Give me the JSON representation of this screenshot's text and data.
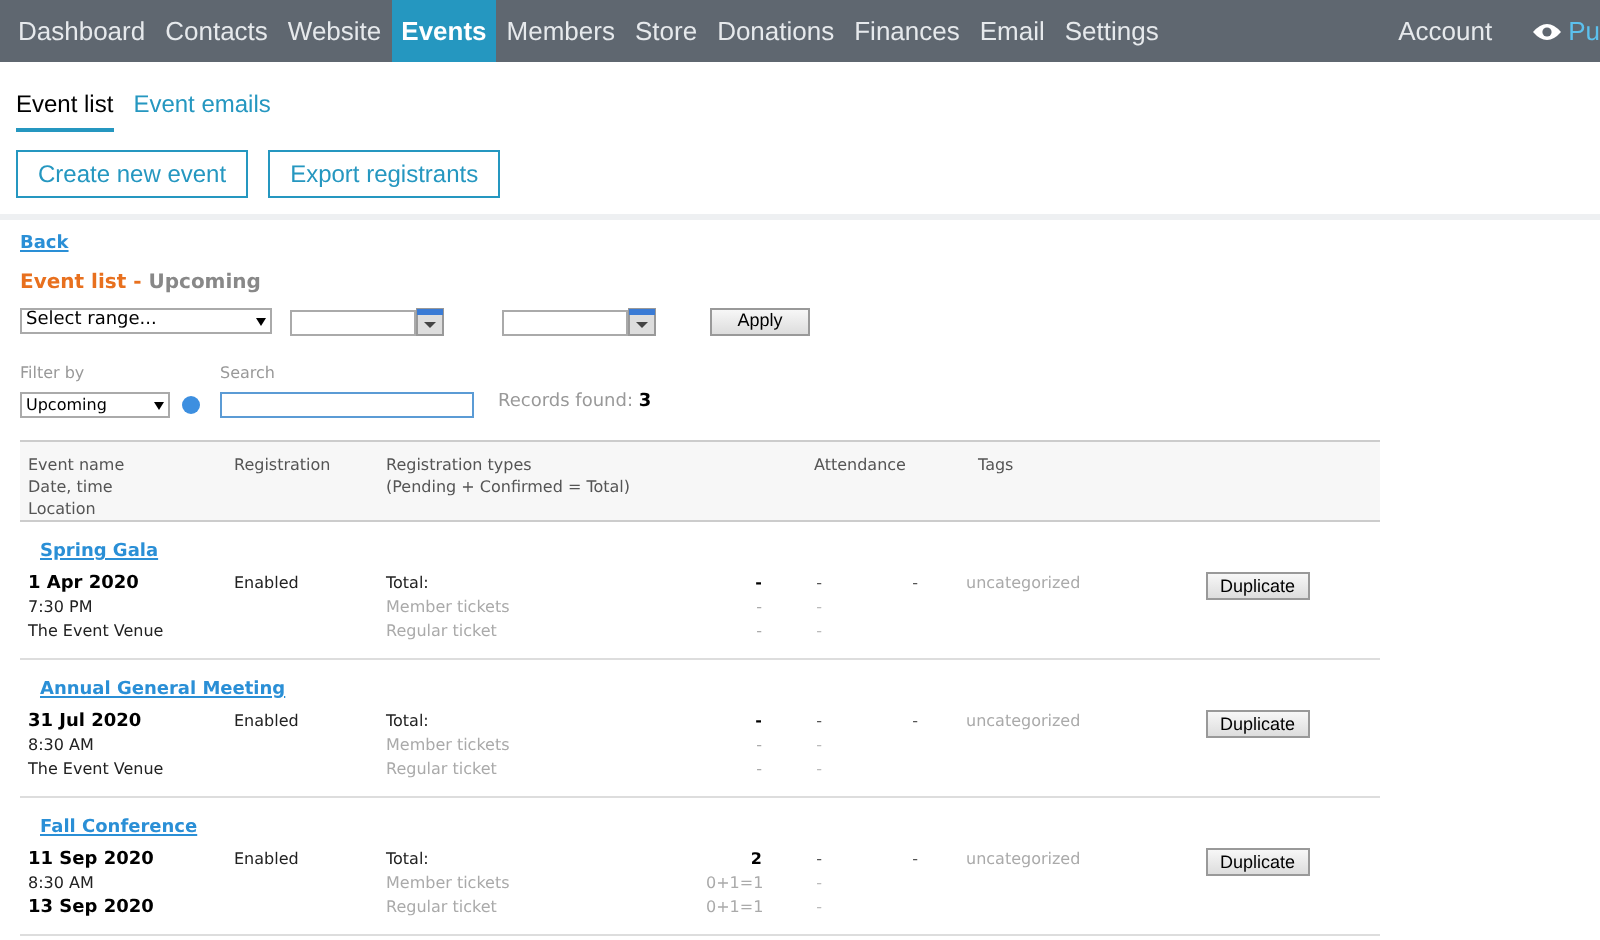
{
  "nav": {
    "items": [
      {
        "label": "Dashboard",
        "selected": false
      },
      {
        "label": "Contacts",
        "selected": false
      },
      {
        "label": "Website",
        "selected": false
      },
      {
        "label": "Events",
        "selected": true
      },
      {
        "label": "Members",
        "selected": false
      },
      {
        "label": "Store",
        "selected": false
      },
      {
        "label": "Donations",
        "selected": false
      },
      {
        "label": "Finances",
        "selected": false
      },
      {
        "label": "Email",
        "selected": false
      },
      {
        "label": "Settings",
        "selected": false
      }
    ],
    "account": "Account",
    "preview": "Pu"
  },
  "tabs": [
    {
      "label": "Event list",
      "selected": true
    },
    {
      "label": "Event emails",
      "selected": false
    }
  ],
  "actions": [
    "Create new event",
    "Export registrants"
  ],
  "back": "Back",
  "heading": {
    "title": "Event list",
    "separator": "-",
    "subtitle": "Upcoming"
  },
  "range": {
    "select": "Select range...",
    "apply": "Apply"
  },
  "filter": {
    "label": "Filter by",
    "value": "Upcoming"
  },
  "search": {
    "label": "Search"
  },
  "records": {
    "label": "Records found:",
    "count": "3"
  },
  "table": {
    "columns": [
      {
        "lines": [
          "Event name",
          "Date, time",
          "Location"
        ]
      },
      {
        "lines": [
          "Registration"
        ]
      },
      {
        "lines": [
          "Registration types",
          "(Pending + Confirmed = Total)"
        ]
      },
      {
        "lines": [
          "Attendance"
        ]
      },
      {
        "lines": [
          "Tags"
        ]
      }
    ],
    "rows": [
      {
        "name": "Spring Gala",
        "details": [
          {
            "text": "1 Apr 2020",
            "kind": "date"
          },
          {
            "text": "7:30 PM",
            "kind": "plain"
          },
          {
            "text": "The Event Venue",
            "kind": "plain"
          }
        ],
        "registration": "Enabled",
        "types": [
          {
            "kind": "total",
            "label": "Total:",
            "count": "-",
            "column_5": "-"
          },
          {
            "kind": "type",
            "label": "Member tickets",
            "count": "-",
            "column_5": "-"
          },
          {
            "kind": "type",
            "label": "Regular ticket",
            "count": "-",
            "column_5": "-"
          }
        ],
        "attendance": "-",
        "tags": "uncategorized",
        "button": "Duplicate"
      },
      {
        "name": "Annual General Meeting",
        "details": [
          {
            "text": "31 Jul 2020",
            "kind": "date"
          },
          {
            "text": "8:30 AM",
            "kind": "plain"
          },
          {
            "text": "The Event Venue",
            "kind": "plain"
          }
        ],
        "registration": "Enabled",
        "types": [
          {
            "kind": "total",
            "label": "Total:",
            "count": "-",
            "column_5": "-"
          },
          {
            "kind": "type",
            "label": "Member tickets",
            "count": "-",
            "column_5": "-"
          },
          {
            "kind": "type",
            "label": "Regular ticket",
            "count": "-",
            "column_5": "-"
          }
        ],
        "attendance": "-",
        "tags": "uncategorized",
        "button": "Duplicate"
      },
      {
        "name": "Fall Conference",
        "details": [
          {
            "text": "11 Sep 2020",
            "kind": "date"
          },
          {
            "text": "8:30 AM",
            "kind": "plain"
          },
          {
            "text": "13 Sep 2020",
            "kind": "date"
          }
        ],
        "registration": "Enabled",
        "types": [
          {
            "kind": "total",
            "label": "Total:",
            "count": "2",
            "column_5": "-"
          },
          {
            "kind": "type",
            "label": "Member tickets",
            "count": "0+1=1",
            "column_5": "-"
          },
          {
            "kind": "type",
            "label": "Regular ticket",
            "count": "0+1=1",
            "column_5": "-"
          }
        ],
        "attendance": "-",
        "tags": "uncategorized",
        "button": "Duplicate"
      }
    ]
  }
}
